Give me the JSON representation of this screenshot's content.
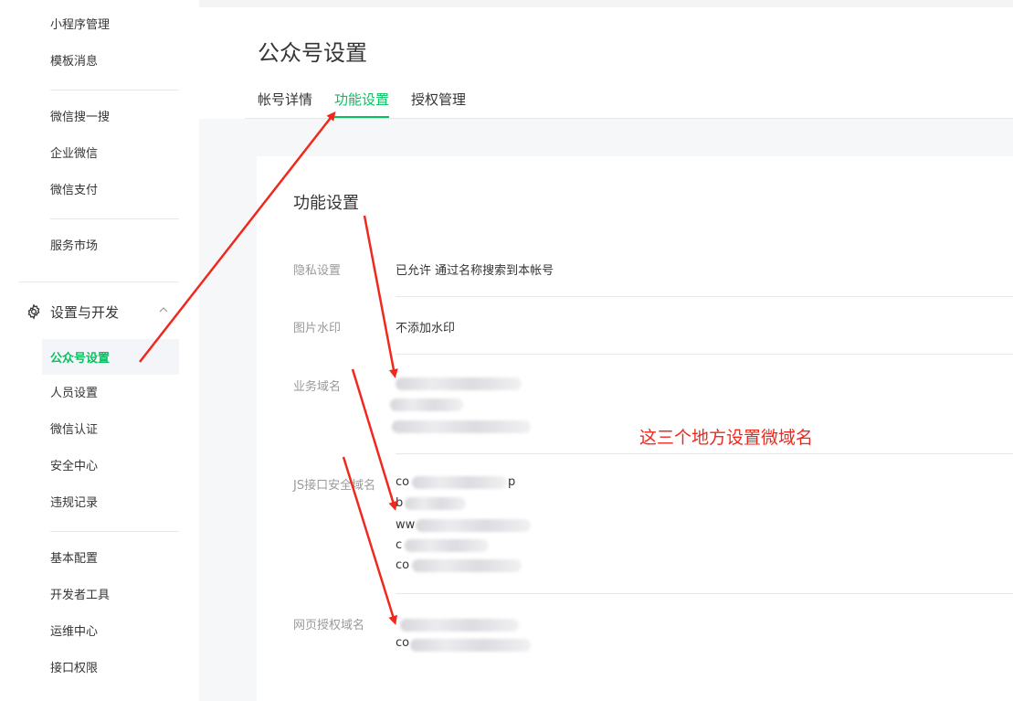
{
  "sidebar": {
    "items_top": [
      "小程序管理",
      "模板消息"
    ],
    "items_mid1": [
      "微信搜一搜",
      "企业微信",
      "微信支付"
    ],
    "items_mid2": [
      "服务市场"
    ],
    "section": "设置与开发",
    "active": "公众号设置",
    "items_section": [
      "人员设置",
      "微信认证",
      "安全中心",
      "违规记录"
    ],
    "items_bottom": [
      "基本配置",
      "开发者工具",
      "运维中心",
      "接口权限"
    ]
  },
  "header": {
    "title": "公众号设置",
    "tabs": [
      "帐号详情",
      "功能设置",
      "授权管理"
    ]
  },
  "card": {
    "title": "功能设置",
    "rows": [
      {
        "label": "隐私设置",
        "value": "已允许 通过名称搜索到本帐号"
      },
      {
        "label": "图片水印",
        "value": "不添加水印"
      },
      {
        "label": "业务域名",
        "value": ""
      },
      {
        "label": "JS接口安全域名",
        "value": ""
      },
      {
        "label": "网页授权域名",
        "value": ""
      }
    ],
    "fragments": {
      "js1": "co",
      "js2": "b",
      "js3": "ww",
      "js4": "c",
      "js5": "co",
      "oauth2": "co",
      "tail1": "p"
    }
  },
  "annotation": "这三个地方设置微域名",
  "colors": {
    "accent": "#07c160",
    "annotation": "#f0281e"
  }
}
